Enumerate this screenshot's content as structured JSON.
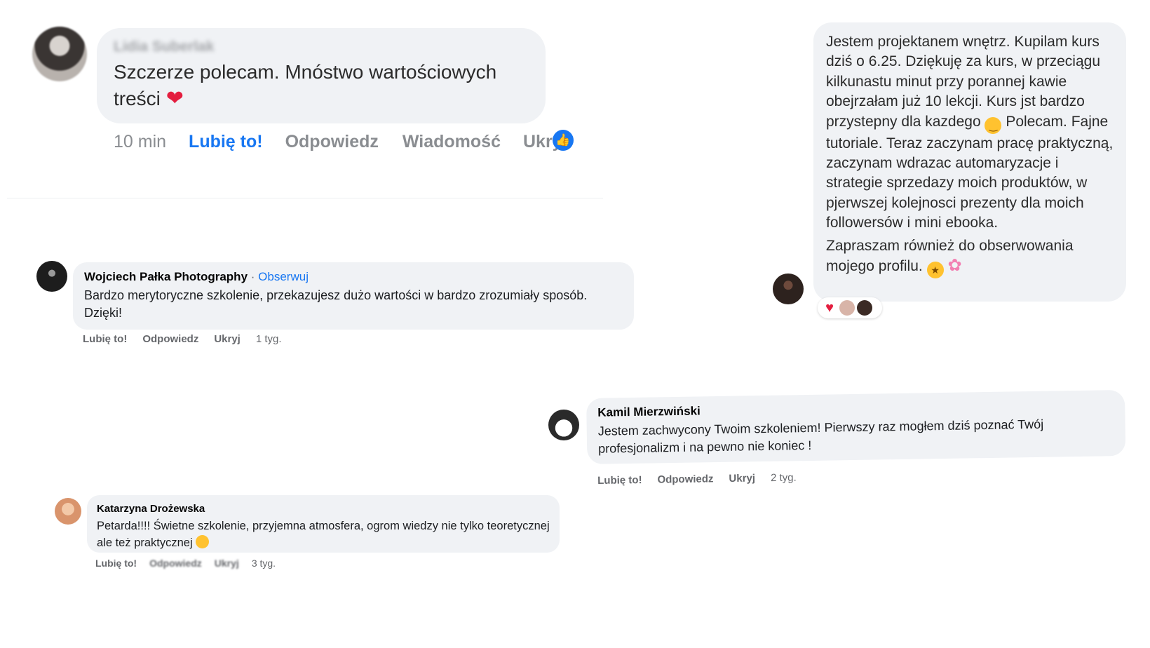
{
  "comments": [
    {
      "author": "Lidia Suberlak",
      "text": "Szczerze polecam. Mnóstwo wartościowych treści",
      "emoji": "❤",
      "actions": {
        "time": "10 min",
        "like": "Lubię to!",
        "reply": "Odpowiedz",
        "message": "Wiadomość",
        "hide": "Ukry"
      }
    },
    {
      "author": "Wojciech Pałka Photography",
      "separator": "·",
      "follow": "Obserwuj",
      "text": "Bardzo merytoryczne szkolenie, przekazujesz dużo wartości w bardzo zrozumiały sposób. Dzięki!",
      "actions": {
        "like": "Lubię to!",
        "reply": "Odpowiedz",
        "hide": "Ukryj",
        "time": "1 tyg."
      }
    },
    {
      "paragraph1": "Jestem projektanem wnętrz. Kupilam kurs dziś  o 6.25. Dziękuję za kurs, w przeciągu kilkunastu minut przy porannej kawie obejrzałam już 10 lekcji. Kurs jst bardzo przystepny dla kazdego",
      "paragraph1_cont": "Polecam. Fajne tutoriale. Teraz zaczynam pracę praktyczną, zaczynam wdrazac automaryzacje i strategie sprzedazy moich produktów,  w pjerwszej kolejnosci prezenty dla moich followersów i mini ebooka.",
      "paragraph2": "Zapraszam również do obserwowania mojego profilu.",
      "reactions": [
        "heart",
        "user",
        "user"
      ]
    },
    {
      "author": "Kamil Mierzwiński",
      "text": "Jestem zachwycony Twoim szkoleniem! Pierwszy raz mogłem dziś poznać Twój profesjonalizm i na pewno nie koniec !",
      "actions": {
        "like": "Lubię to!",
        "reply": "Odpowiedz",
        "hide": "Ukryj",
        "time": "2 tyg."
      }
    },
    {
      "author": "Katarzyna Drożewska",
      "text": "Petarda!!!! Świetne szkolenie, przyjemna atmosfera, ogrom wiedzy nie tylko teoretycznej ale też praktycznej",
      "actions": {
        "like": "Lubię to!",
        "reply": "Odpowiedz",
        "hide": "Ukryj",
        "time": "3 tyg."
      }
    }
  ],
  "colors": {
    "bubble": "#f0f2f5",
    "link": "#1877f2",
    "heart": "#e41e3f",
    "muted": "#65676b"
  }
}
